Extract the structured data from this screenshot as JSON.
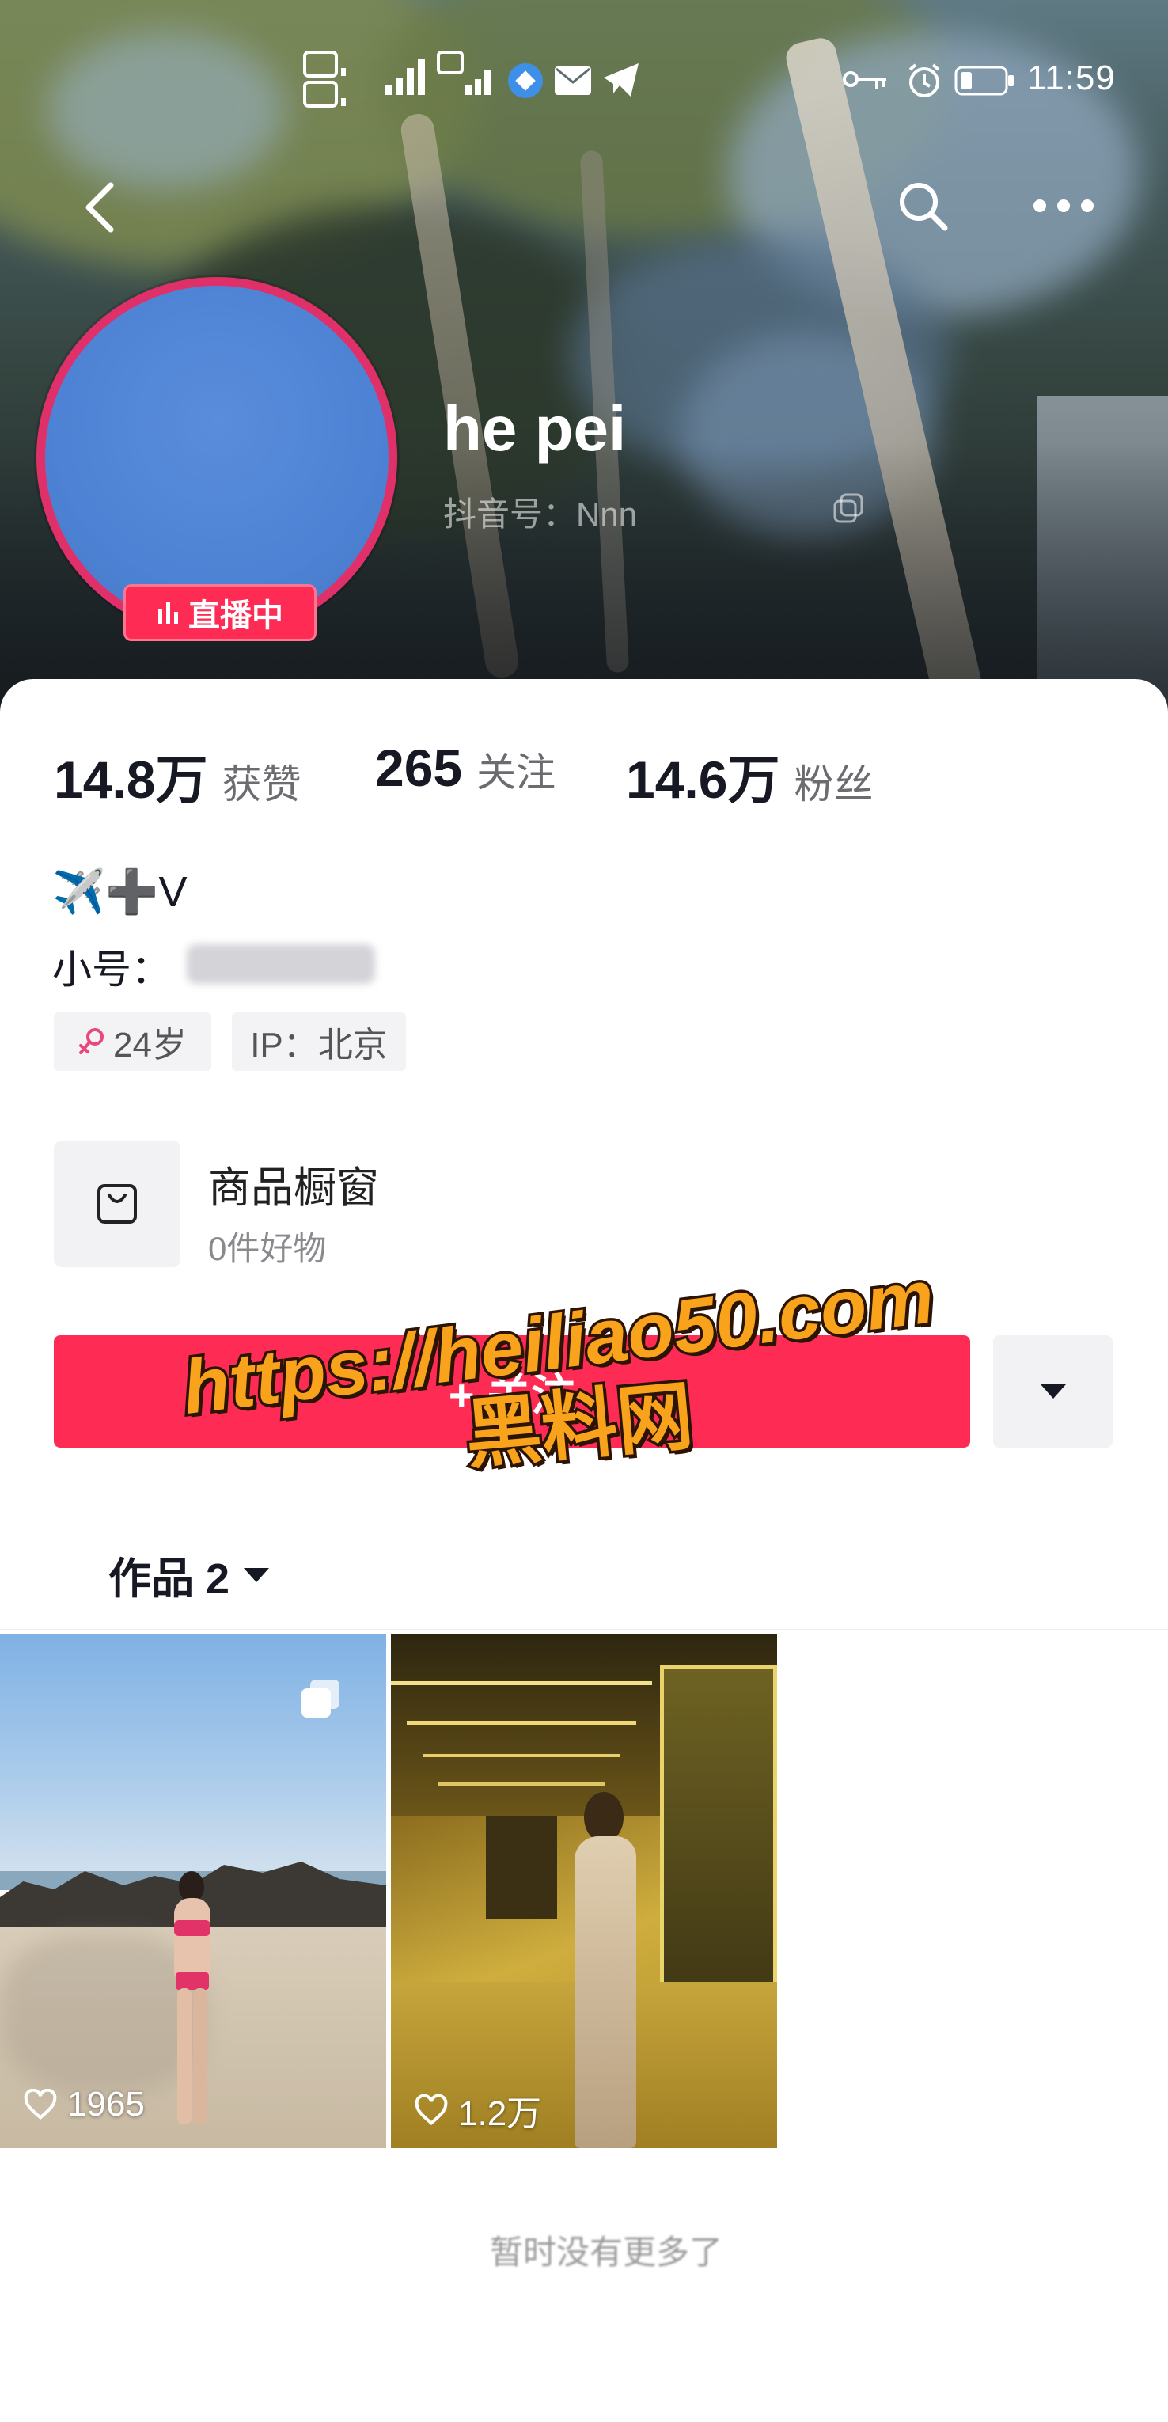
{
  "status_bar": {
    "time": "11:59",
    "icons": [
      "hd-signal-icon",
      "signal-icon",
      "hd-signal-icon",
      "app-notification-icon",
      "mail-icon",
      "telegram-icon",
      "key-icon",
      "alarm-icon",
      "battery-icon"
    ]
  },
  "nav": {
    "icons": [
      "back-icon",
      "search-icon",
      "more-icon"
    ]
  },
  "profile": {
    "name": "he pei",
    "douyin_id": "抖音号：Nnn",
    "live_badge": "直播中",
    "avatar_color": "#4D82D4"
  },
  "stats": [
    {
      "value": "14.8万",
      "label": "获赞"
    },
    {
      "value": "265",
      "label": "关注"
    },
    {
      "value": "14.6万",
      "label": "粉丝"
    }
  ],
  "bio": {
    "line1": "✈️➕V",
    "line2": "小号："
  },
  "tags": [
    {
      "icon": "female-icon",
      "text": "24岁"
    },
    {
      "text": "IP：北京"
    }
  ],
  "shop": {
    "icon": "shopping-bag-icon",
    "title": "商品橱窗",
    "subtitle": "0件好物"
  },
  "follow": {
    "label": "+ 关注"
  },
  "tabs": {
    "works_label": "作品 2"
  },
  "works": [
    {
      "likes": "1965",
      "multi_image": true
    },
    {
      "likes": "1.2万",
      "multi_image": false
    }
  ],
  "footer": {
    "text": "暂时没有更多了"
  },
  "watermark": {
    "url": "https://heiliao50.com",
    "site_name": "黑料网"
  },
  "colors": {
    "accent": "#FE2C55",
    "avatar_ring": "#E0306A",
    "watermark_fill": "#F8A31B",
    "text_primary": "#161823",
    "text_secondary": "#6B6B70"
  }
}
